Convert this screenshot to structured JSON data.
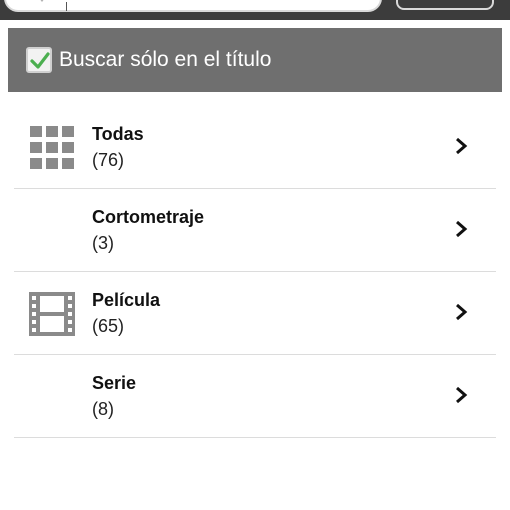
{
  "search": {
    "placeholder": "",
    "value": ""
  },
  "filter": {
    "checkbox_checked": true,
    "label": "Buscar sólo en el título"
  },
  "categories": [
    {
      "title": "Todas",
      "count": "(76)",
      "icon": "grid-icon"
    },
    {
      "title": "Cortometraje",
      "count": "(3)",
      "icon": ""
    },
    {
      "title": "Película",
      "count": "(65)",
      "icon": "film-icon"
    },
    {
      "title": "Serie",
      "count": "(8)",
      "icon": ""
    }
  ],
  "colors": {
    "top_bar": "#3c3c3c",
    "filter_bar": "#6f6f6f",
    "icon_gray": "#8a8a8a",
    "check_green": "#4caf50"
  }
}
